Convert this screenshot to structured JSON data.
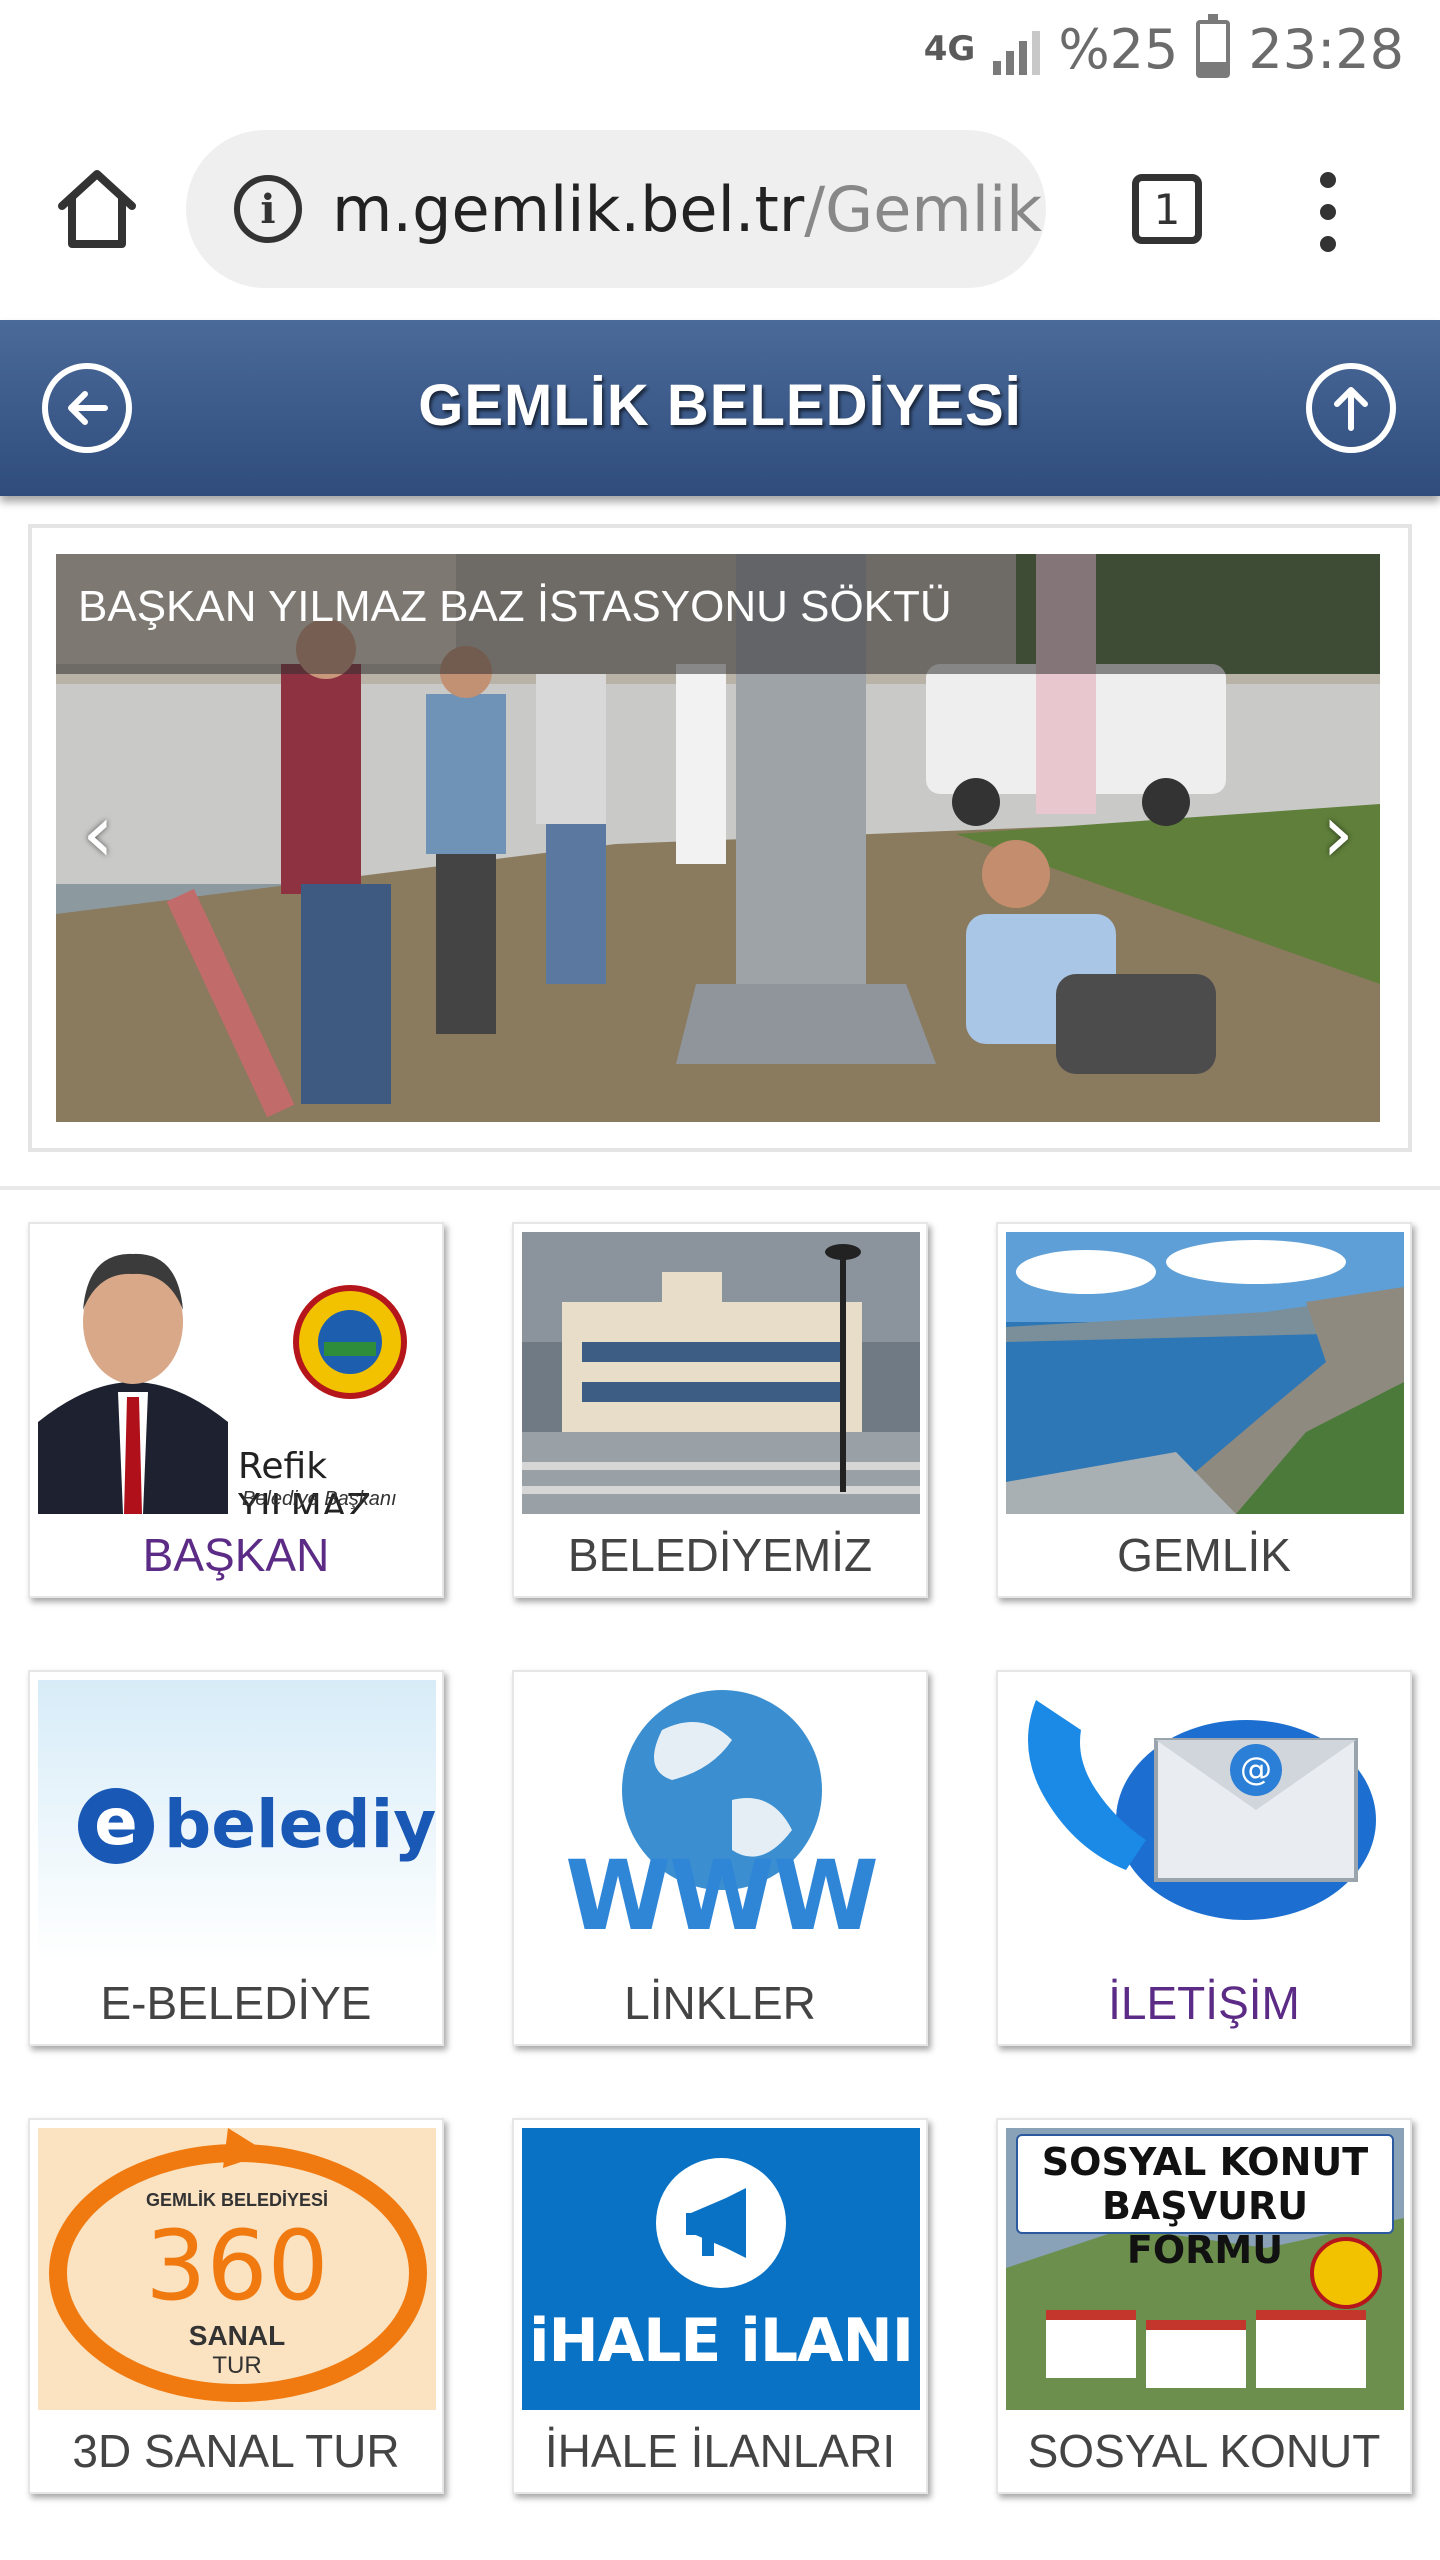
{
  "status_bar": {
    "network": "4G",
    "battery": "%25",
    "battery_level": 0.25,
    "time": "23:28"
  },
  "browser": {
    "url_host": "m.gemlik.bel.tr",
    "url_path": "/GemlikE",
    "tab_count": "1"
  },
  "header": {
    "title": "GEMLİK BELEDİYESİ"
  },
  "slider": {
    "caption": "BAŞKAN YILMAZ BAZ İSTASYONU SÖKTÜ",
    "prev": "‹",
    "next": "›"
  },
  "tiles": {
    "baskan": {
      "label": "BAŞKAN",
      "img_name": "Refik YILMAZ",
      "img_title": "Belediye Başkanı"
    },
    "belediyemiz": {
      "label": "BELEDİYEMİZ"
    },
    "gemlik": {
      "label": "GEMLİK"
    },
    "ebelediye": {
      "label": "E-BELEDİYE",
      "img_text": "belediye"
    },
    "linkler": {
      "label": "LİNKLER",
      "img_text": "WWW"
    },
    "iletisim": {
      "label": "İLETİŞİM"
    },
    "sanaltur": {
      "label": "3D SANAL TUR",
      "img_top": "GEMLİK BELEDİYESİ",
      "img_num": "360",
      "img_sub1": "SANAL",
      "img_sub2": "TUR"
    },
    "ihale": {
      "label": "İHALE İLANLARI",
      "img_text": "iHALE iLANI"
    },
    "sosyal": {
      "label": "SOSYAL KONUT",
      "img_line1": "SOSYAL KONUT",
      "img_line2": "BAŞVURU FORMU"
    }
  },
  "colors": {
    "header_top": "#4a6a99",
    "header_bottom": "#2f4c7c",
    "visited_link": "#5b2b86",
    "label_text": "#444444",
    "ihale_blue": "#0a72c4"
  }
}
